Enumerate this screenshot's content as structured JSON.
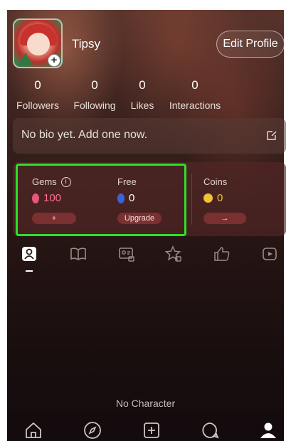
{
  "profile": {
    "username": "Tipsy",
    "edit_label": "Edit Profile"
  },
  "stats": [
    {
      "value": "0",
      "label": "Followers"
    },
    {
      "value": "0",
      "label": "Following"
    },
    {
      "value": "0",
      "label": "Likes"
    },
    {
      "value": "0",
      "label": "Interactions"
    }
  ],
  "bio": {
    "placeholder": "No bio yet. Add one now."
  },
  "wallet": {
    "gems": {
      "title": "Gems",
      "value": "100",
      "button": "+"
    },
    "free": {
      "title": "Free",
      "value": "0",
      "button": "Upgrade"
    },
    "coins": {
      "title": "Coins",
      "value": "0",
      "button": "→"
    }
  },
  "tabs": [
    "user-icon",
    "book-icon",
    "id-card-lock-icon",
    "star-lock-icon",
    "thumb-up-icon",
    "video-play-icon"
  ],
  "content": {
    "empty_message": "No Character"
  },
  "bottom_nav": [
    "home-icon",
    "compass-icon",
    "add-icon",
    "chat-icon",
    "profile-icon"
  ],
  "colors": {
    "highlight": "#2ee02a",
    "gem_pink": "#e8567a",
    "gem_blue": "#3b63d8",
    "coin_gold": "#f0c23a",
    "button_red": "#7a3030"
  }
}
